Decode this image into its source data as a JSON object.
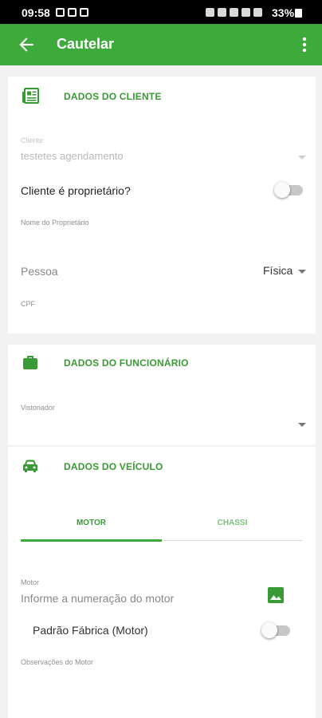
{
  "status_bar": {
    "time": "09:58",
    "battery": "33%",
    "left_icons": [
      "photo-icon",
      "gallery-icon",
      "gmail-icon"
    ],
    "right_icons": [
      "alarm-icon",
      "alarm-icon",
      "vibrate-icon",
      "wifi-icon",
      "signal-icon"
    ]
  },
  "app_bar": {
    "title": "Cautelar",
    "color": "#3faa3c",
    "back_icon": "arrow-left-icon",
    "menu_icon": "more-vertical-icon"
  },
  "client_section": {
    "title": "DADOS DO CLIENTE",
    "icon": "newspaper-icon",
    "cliente_label": "Cliente",
    "cliente_value": "testetes agendamento",
    "proprietario_label": "Cliente é proprietário?",
    "proprietario_on": false,
    "nome_proprietario_label": "Nome do Proprietário",
    "pessoa_label": "Pessoa",
    "pessoa_value": "Física",
    "cpf_label": "CPF"
  },
  "employee_section": {
    "title": "DADOS DO FUNCIONÁRIO",
    "icon": "briefcase-icon",
    "vistoriador_label": "Vistoriador",
    "vistoriador_value": ""
  },
  "vehicle_section": {
    "title": "DADOS DO VEÍCULO",
    "icon": "car-icon",
    "tabs": [
      {
        "label": "MOTOR",
        "active": true
      },
      {
        "label": "CHASSI",
        "active": false
      }
    ],
    "motor_label": "Motor",
    "motor_placeholder": "Informe a numeração do motor",
    "image_icon": "image-icon",
    "padrao_label": "Padrão Fábrica (Motor)",
    "padrao_on": false,
    "observacoes_label": "Observações do Motor"
  },
  "colors": {
    "accent": "#3faa3c",
    "section_text": "#3a9a35",
    "background": "#f2f2f2"
  }
}
